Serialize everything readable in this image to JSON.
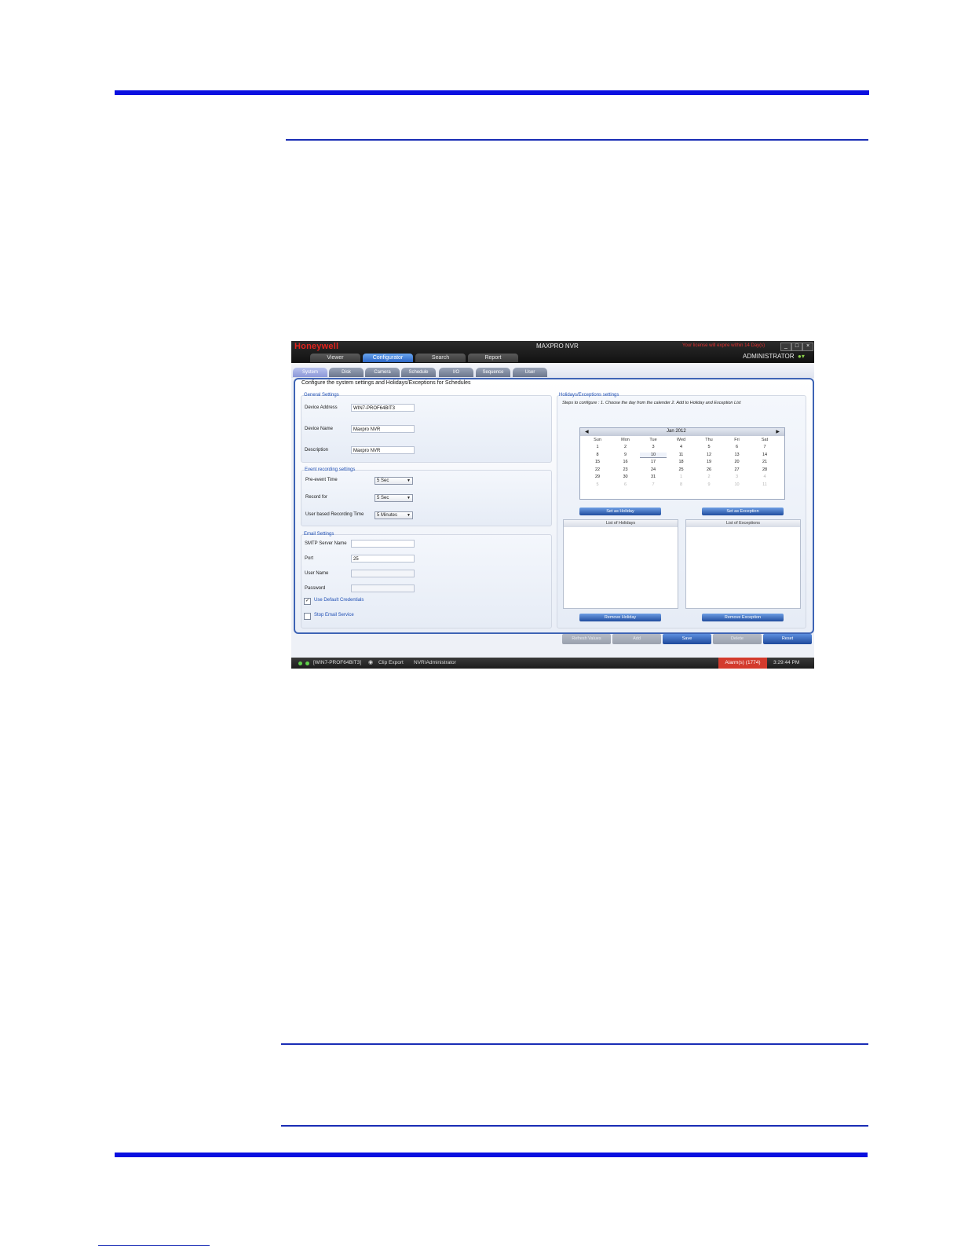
{
  "app": {
    "logo": "Honeywell",
    "title": "MAXPRO NVR",
    "license_notice": "Your license will expire within 14 Day(s)",
    "user": "ADMINISTRATOR",
    "main_tabs": [
      "Viewer",
      "Configurator",
      "Search",
      "Report"
    ],
    "active_main_tab": "Configurator",
    "sub_tabs": [
      "System",
      "Disk",
      "Camera",
      "Schedule",
      "I/O",
      "Sequence",
      "User"
    ],
    "active_sub_tab": "System",
    "panel_caption": "Configure the system settings and Holidays/Exceptions for Schedules",
    "general": {
      "title": "General Settings",
      "device_address_label": "Device Address",
      "device_address": "WIN7-PROF64BIT3",
      "device_name_label": "Device Name",
      "device_name": "Maxpro NVR",
      "description_label": "Description",
      "description": "Maxpro NVR"
    },
    "event": {
      "title": "Event recording settings",
      "pre_event_label": "Pre-event Time",
      "pre_event_value": "5 Sec",
      "record_for_label": "Record for",
      "record_for_value": "5 Sec",
      "user_rec_label": "User based Recording Time",
      "user_rec_value": "5 Minutes"
    },
    "email": {
      "title": "Email Settings",
      "smtp_label": "SMTP Server Name",
      "smtp_value": "",
      "port_label": "Port",
      "port_value": "25",
      "username_label": "User Name",
      "password_label": "Password",
      "use_default_label": "Use Default Credentials",
      "use_default_checked": true,
      "stop_email_label": "Stop Email Service",
      "stop_email_checked": false
    },
    "holidays": {
      "title": "Holidays/Exceptions settings",
      "steps": "Steps to configure : 1. Choose the day from the calender  2. Add to Holiday and Exception List",
      "calendar_month": "Jan 2012",
      "dow": [
        "Sun",
        "Mon",
        "Tue",
        "Wed",
        "Thu",
        "Fri",
        "Sat"
      ],
      "weeks": [
        [
          "1",
          "2",
          "3",
          "4",
          "5",
          "6",
          "7"
        ],
        [
          "8",
          "9",
          "10",
          "11",
          "12",
          "13",
          "14"
        ],
        [
          "15",
          "16",
          "17",
          "18",
          "19",
          "20",
          "21"
        ],
        [
          "22",
          "23",
          "24",
          "25",
          "26",
          "27",
          "28"
        ],
        [
          "29",
          "30",
          "31",
          "1",
          "2",
          "3",
          "4"
        ],
        [
          "5",
          "6",
          "7",
          "8",
          "9",
          "10",
          "11"
        ]
      ],
      "selected_day": "10",
      "set_holiday": "Set as Holiday",
      "set_exception": "Set as Exception",
      "list_holidays": "List of Holidays",
      "list_exceptions": "List of Exceptions",
      "remove_holiday": "Remove Holiday",
      "remove_exception": "Remove Exception"
    },
    "actions": [
      "Refresh Values",
      "Add",
      "Save",
      "Delete",
      "Reset"
    ],
    "status": {
      "host": "[WIN7-PROF64BIT3]",
      "clip_export": "Clip Export",
      "user": "NVR\\Administrator",
      "alarm": "Alarm(s) (1774)",
      "clock": "3:29:44 PM"
    }
  }
}
